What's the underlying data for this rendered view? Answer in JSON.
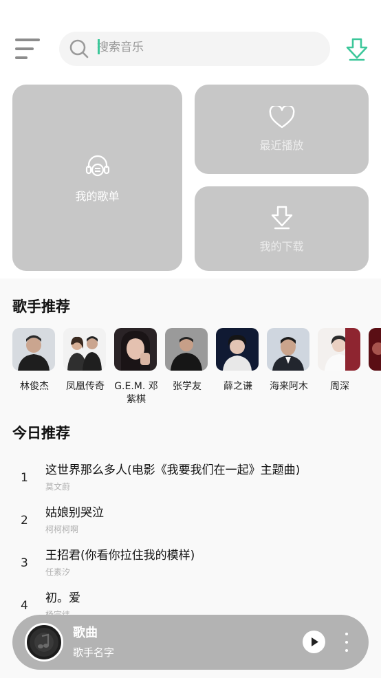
{
  "header": {
    "menu_icon": "menu-icon",
    "search": {
      "placeholder": "搜索音乐",
      "icon": "search-icon"
    },
    "download_icon": "download-icon",
    "accent_color": "#3cc79a"
  },
  "cards": {
    "my_playlist": {
      "label": "我的歌单",
      "icon": "headphones-icon"
    },
    "recent": {
      "label": "最近播放",
      "icon": "heart-icon"
    },
    "downloads": {
      "label": "我的下载",
      "icon": "download-icon"
    }
  },
  "singers_section": {
    "title": "歌手推荐",
    "items": [
      {
        "name": "林俊杰"
      },
      {
        "name": "凤凰传奇"
      },
      {
        "name": "G.E.M. 邓紫棋"
      },
      {
        "name": "张学友"
      },
      {
        "name": "薛之谦"
      },
      {
        "name": "海来阿木"
      },
      {
        "name": "周深"
      },
      {
        "name": ""
      }
    ]
  },
  "today_section": {
    "title": "今日推荐",
    "songs": [
      {
        "index": "1",
        "title": "这世界那么多人(电影《我要我们在一起》主题曲)",
        "artist": "莫文蔚"
      },
      {
        "index": "2",
        "title": "姑娘别哭泣",
        "artist": "柯柯柯啊"
      },
      {
        "index": "3",
        "title": "王招君(你看你拉住我的模样)",
        "artist": "任素汐"
      },
      {
        "index": "4",
        "title": "初。爱",
        "artist": "杨宗纬"
      }
    ]
  },
  "player": {
    "song": "歌曲",
    "artist": "歌手名字",
    "play_icon": "play-icon",
    "more_icon": "more-vertical-icon"
  }
}
